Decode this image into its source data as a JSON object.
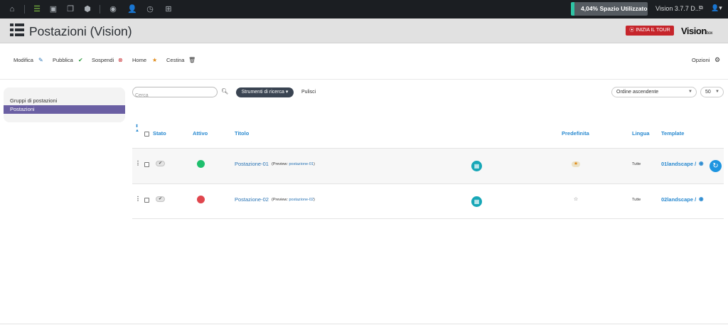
{
  "topbar": {
    "icons": [
      "home-icon",
      "list-icon",
      "image-icon",
      "windows-icon",
      "cube-icon",
      "eye-icon",
      "user-settings-icon",
      "clock-icon",
      "grid-icon"
    ],
    "usage_text": "4,04% Spazio Utilizzato",
    "usage_fraction": 0.0404,
    "usage_color": "#2fc4a5",
    "version_text": "Vision 3.7.7 D...",
    "version_ext_glyph": "⧉",
    "user_glyph": "👤▾"
  },
  "header": {
    "title": "Postazioni (Vision)",
    "tour_label": "INIZIA IL TOUR",
    "brand_main": "Vision",
    "brand_sub": "box"
  },
  "toolbar": {
    "edit_label": "Modifica",
    "publish_label": "Pubblica",
    "suspend_label": "Sospendi",
    "home_label": "Home",
    "trash_label": "Cestina",
    "options_label": "Opzioni"
  },
  "sidebar": {
    "items": [
      {
        "label": "Gruppi di postazioni",
        "active": false
      },
      {
        "label": "Postazioni",
        "active": true
      }
    ],
    "active_color": "#6a5fa3"
  },
  "filters": {
    "search_placeholder": "Cerca",
    "search_value": "",
    "tools_label": "Strumenti di ricerca ▾",
    "clear_label": "Pulisci",
    "order_value": "Ordine ascendente",
    "limit_value": "50"
  },
  "table": {
    "headers": {
      "stato": "Stato",
      "attivo": "Attivo",
      "titolo": "Titolo",
      "predefinita": "Predefinita",
      "lingua": "Lingua",
      "template": "Template"
    },
    "rows": [
      {
        "title": "Postazione-01",
        "preview_prefix": "(Preview: ",
        "preview_alias": "postazione-01",
        "preview_suffix": ")",
        "active_color": "#1fbf6d",
        "default": true,
        "lingua": "Tutte",
        "template": "01landscape /"
      },
      {
        "title": "Postazione-02",
        "preview_prefix": "(Preview: ",
        "preview_alias": "postazione-02",
        "preview_suffix": ")",
        "active_color": "#e0464d",
        "default": false,
        "lingua": "Tutte",
        "template": "02landscape /"
      }
    ]
  },
  "colors": {
    "link": "#2a74b5",
    "header_link": "#2a8ad0",
    "calendar_button": "#17a7b7",
    "refresh_button": "#1d95e0",
    "tour_button": "#c6252b"
  }
}
